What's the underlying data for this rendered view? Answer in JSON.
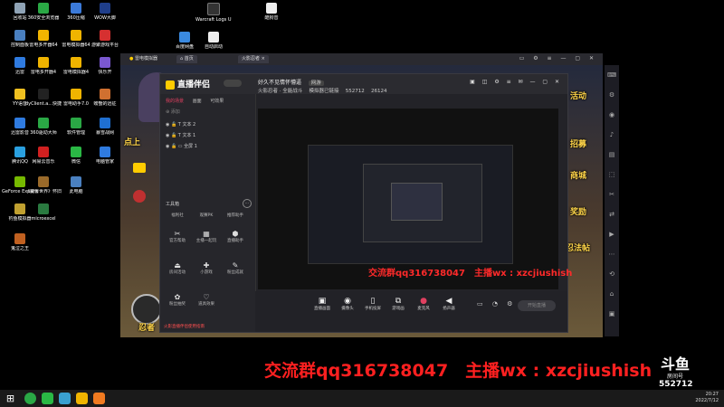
{
  "desktop": {
    "icons": [
      {
        "label": "回收站",
        "color": "#8fa3b5"
      },
      {
        "label": "360安全浏览器",
        "color": "#2aa845"
      },
      {
        "label": "360压缩",
        "color": "#3b7ad9"
      },
      {
        "label": "WOW大脚",
        "color": "#1f3e8a"
      },
      {
        "label": "控制面板",
        "color": "#4a80c0"
      },
      {
        "label": "雷电多开器64",
        "color": "#f0b400"
      },
      {
        "label": "雷电模拟器64",
        "color": "#f0b400"
      },
      {
        "label": "游聚游戏平台",
        "color": "#d63030"
      },
      {
        "label": "迅雷",
        "color": "#2f7be0"
      },
      {
        "label": "雷电多开器4",
        "color": "#f0b400"
      },
      {
        "label": "雷电模拟器4",
        "color": "#f0b400"
      },
      {
        "label": "快乐开",
        "color": "#7a58d0"
      },
      {
        "label": "YY语音",
        "color": "#f0c020"
      },
      {
        "label": "dyClient.a...快捷方式",
        "color": "#222"
      },
      {
        "label": "雷电助手7.0",
        "color": "#f0b400"
      },
      {
        "label": "螃蟹的远征",
        "color": "#d07030"
      },
      {
        "label": "迅雷影音",
        "color": "#2f7be0"
      },
      {
        "label": "360驱动大师",
        "color": "#2aa845"
      },
      {
        "label": "软件管理",
        "color": "#2aa845"
      },
      {
        "label": "暴雪战网",
        "color": "#1f6fd0"
      },
      {
        "label": "腾讯QQ",
        "color": "#2aa0e0"
      },
      {
        "label": "网易云音乐",
        "color": "#d02020"
      },
      {
        "label": "微信",
        "color": "#2ab845"
      },
      {
        "label": "电脑管家",
        "color": "#2f7be0"
      },
      {
        "label": "GeForce Experience",
        "color": "#76b900"
      },
      {
        "label": "《魔兽世界》怀旧服",
        "color": "#9a6a2a"
      },
      {
        "label": "此电脑",
        "color": "#4a80c0"
      },
      {
        "label": "",
        "color": "transparent"
      },
      {
        "label": "钓鱼模拟器",
        "color": "#c0a030"
      },
      {
        "label": "microexcel",
        "color": "#2a7a40"
      },
      {
        "label": "",
        "color": "transparent"
      },
      {
        "label": "",
        "color": "transparent"
      },
      {
        "label": "鬼泣之王",
        "color": "#c06020"
      }
    ],
    "top_icons": [
      {
        "label": "Warcraft Logs U...",
        "color": "#333"
      },
      {
        "label": "酷狗音",
        "color": "#eee"
      },
      {
        "label": "百度网盘",
        "color": "#3a8ae0"
      },
      {
        "label": "自动启动",
        "color": "#eee"
      }
    ]
  },
  "emulator": {
    "tabs": [
      "雷电模拟器",
      "首页",
      "火影忍者"
    ],
    "game_buttons": [
      "活动",
      "招募",
      "商城",
      "奖励",
      "忍法帖",
      "忍者"
    ],
    "game_left_text": "点上"
  },
  "app": {
    "logo": "直播伴侣",
    "stream_title": "好久不见情怀懵逼",
    "tag": "网游",
    "sub_info": [
      "火影忍者 · 全能战斗",
      "模拟器已链接",
      "552712",
      "26124"
    ],
    "panel_tabs": [
      "我的场景",
      "画面",
      "可效果"
    ],
    "scene_label": "添加",
    "sources": [
      "文本 2",
      "文本 1",
      "全屏 1"
    ],
    "toolbox_title": "工具箱",
    "tools": [
      "福利社",
      "观赛PK",
      "推荐助手",
      "官方帮助",
      "主播一起玩",
      "直播助手",
      "房间活动",
      "小游戏",
      "粉丝成就",
      "粉丝抽奖",
      "道具效果"
    ],
    "bottom_tools": [
      "直播画面",
      "摄像头",
      "手机投屏",
      "游戏画",
      "麦克风",
      "扬声器"
    ],
    "go_live": "开始直播",
    "notice": "火影直播伴侣使用指南"
  },
  "overlay_small": "交流群qq316738047　主播wx : xzcjiushish",
  "overlay_big": "交流群qq316738047　主播wx :  xzcjiushish",
  "room": {
    "brand": "斗鱼",
    "label": "房间号",
    "number": "552712"
  },
  "clock": {
    "time": "20:27",
    "date": "2022/7/12"
  }
}
